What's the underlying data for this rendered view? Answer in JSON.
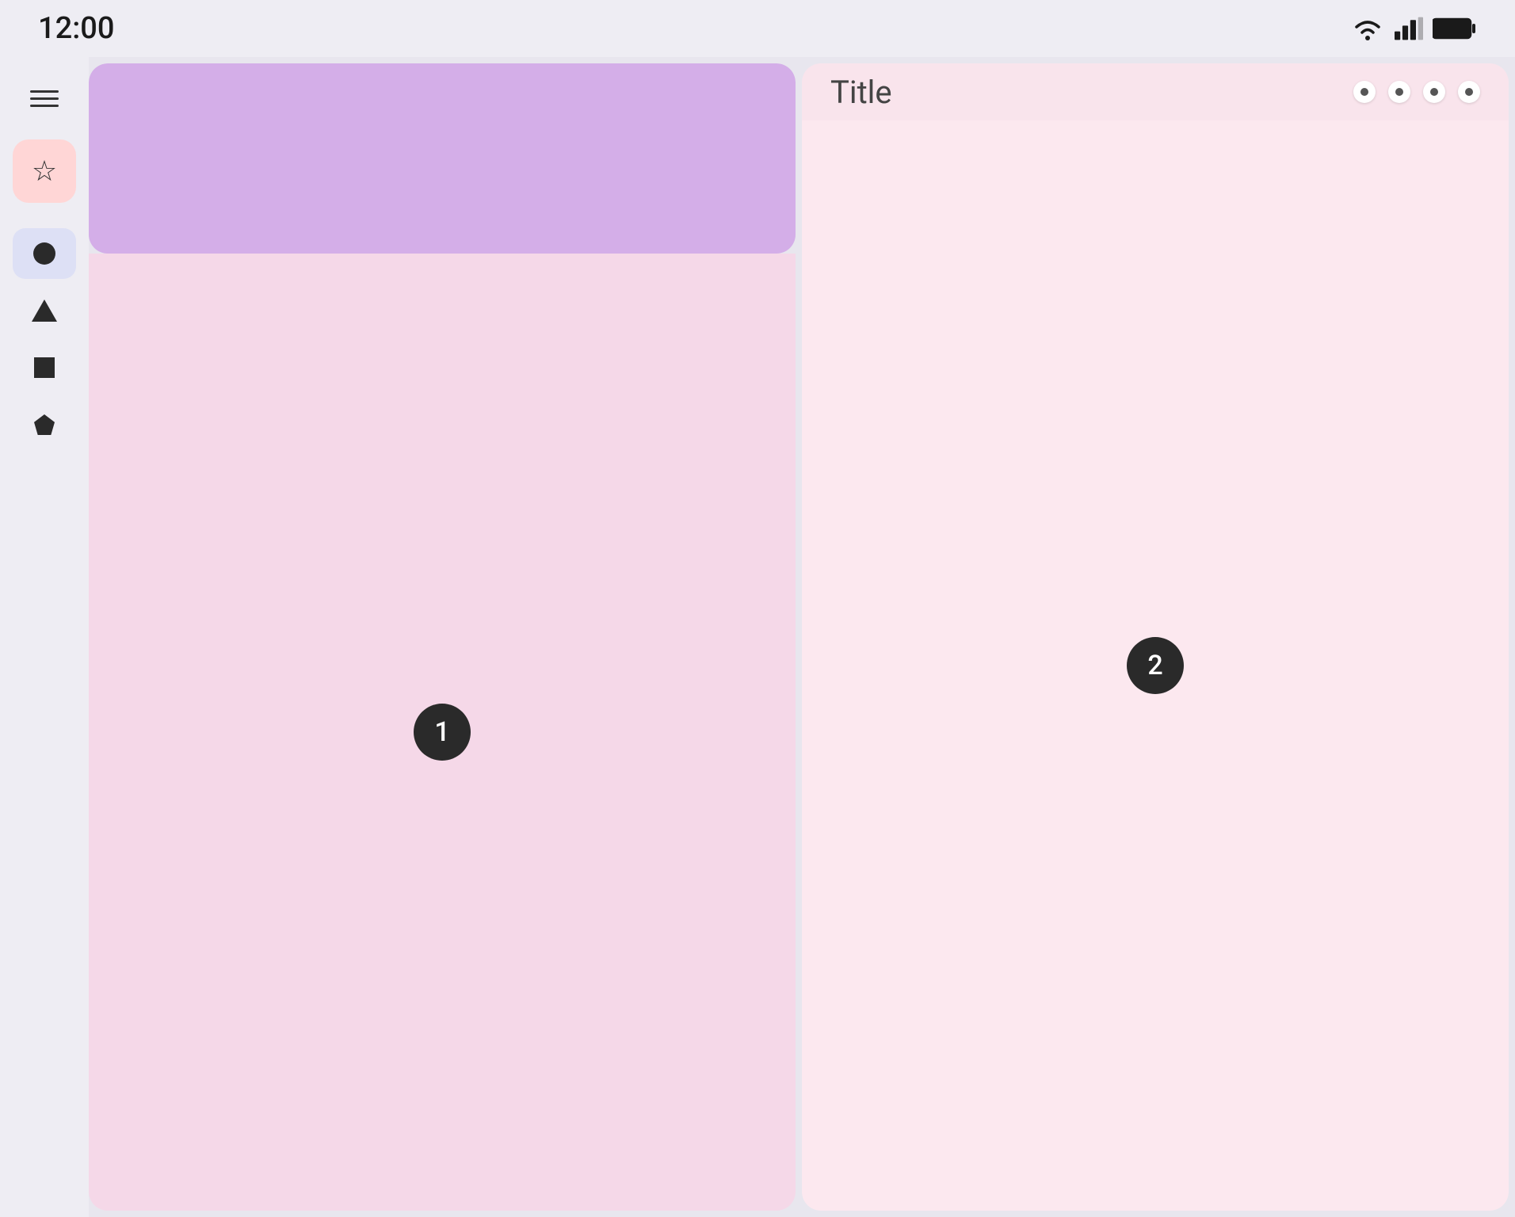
{
  "statusBar": {
    "time": "12:00"
  },
  "sidebar": {
    "menuLabel": "menu",
    "starLabel": "Favorites",
    "items": [
      {
        "id": "circle",
        "label": "Circle",
        "active": true
      },
      {
        "id": "triangle",
        "label": "Triangle",
        "active": false
      },
      {
        "id": "square",
        "label": "Square",
        "active": false
      },
      {
        "id": "pentagon",
        "label": "Pentagon",
        "active": false
      }
    ]
  },
  "leftPanel": {
    "badge": "1"
  },
  "rightPanel": {
    "title": "Title",
    "headerDots": 4,
    "badge": "2"
  }
}
